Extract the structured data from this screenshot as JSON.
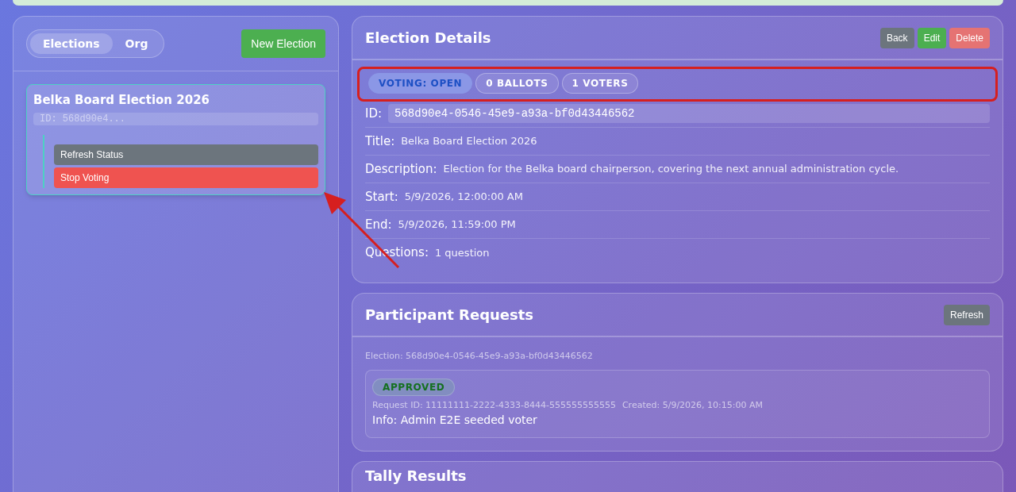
{
  "tabs": [
    {
      "label": "Elections",
      "selected": true
    },
    {
      "label": "Org",
      "selected": false
    }
  ],
  "new_election_button": "New Election",
  "election_card": {
    "title": "Belka Board Election 2026",
    "id": "ID: 568d90e4...",
    "actions": [
      {
        "label": "Refresh Status",
        "kind": "neutral"
      },
      {
        "label": "Stop Voting",
        "kind": "danger"
      }
    ]
  },
  "details": {
    "title": "Election Details",
    "buttons": [
      {
        "label": "Back",
        "kind": "neutral"
      },
      {
        "label": "Edit",
        "kind": "success"
      },
      {
        "label": "Delete",
        "kind": "danger"
      }
    ],
    "badges": [
      {
        "label": "VOTING: OPEN",
        "kind": "status"
      },
      {
        "label": "0 BALLOTS",
        "kind": "count"
      },
      {
        "label": "1 VOTERS",
        "kind": "count"
      }
    ],
    "fields": [
      {
        "label": "ID:",
        "value": "568d90e4-0546-45e9-a93a-bf0d43446562",
        "kind": "code"
      },
      {
        "label": "Title:",
        "value": "Belka Board Election 2026",
        "kind": "text"
      },
      {
        "label": "Description:",
        "value": "Election for the Belka board chairperson, covering the next annual administration cycle.",
        "kind": "text"
      },
      {
        "label": "Start:",
        "value": "5/9/2026, 12:00:00 AM",
        "kind": "text"
      },
      {
        "label": "End:",
        "value": "5/9/2026, 11:59:00 PM",
        "kind": "text"
      },
      {
        "label": "Questions:",
        "value": "1 question",
        "kind": "text"
      }
    ]
  },
  "participant_requests": {
    "title": "Participant Requests",
    "refresh_button": "Refresh",
    "election": "Election: 568d90e4-0546-45e9-a93a-bf0d43446562",
    "requests": [
      {
        "status": "APPROVED",
        "request_id": "Request ID: 11111111-2222-4333-8444-555555555555",
        "created": "Created: 5/9/2026, 10:15:00 AM",
        "info": "Info: Admin E2E seeded voter"
      }
    ]
  },
  "tally": {
    "title": "Tally Results"
  }
}
